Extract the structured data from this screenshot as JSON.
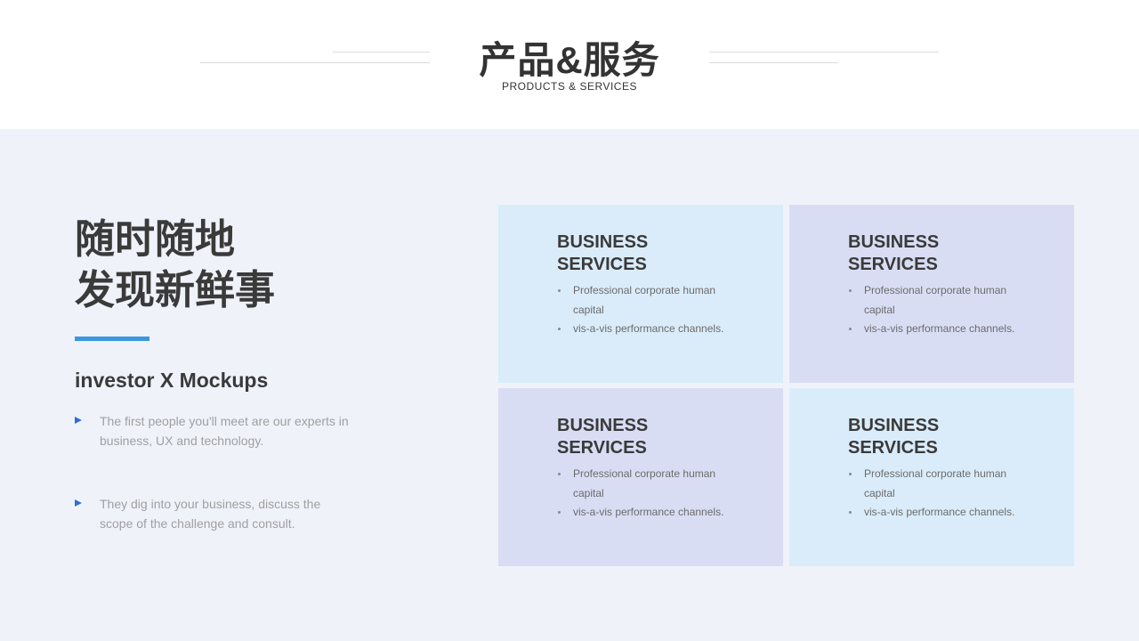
{
  "header": {
    "title": "产品&服务",
    "subtitle": "PRODUCTS & SERVICES"
  },
  "left": {
    "headline_line1": "随时随地",
    "headline_line2": "发现新鲜事",
    "subheading": "investor X Mockups",
    "bullets": [
      "The first people you'll meet are our experts in business, UX  and technology.",
      "They dig into your business, discuss the scope of the challenge and consult."
    ]
  },
  "cards": [
    {
      "title_line1": "BUSINESS",
      "title_line2": "SERVICES",
      "items": [
        "Professional corporate human capital",
        "vis-a-vis performance channels."
      ],
      "color": "#daecfa"
    },
    {
      "title_line1": "BUSINESS",
      "title_line2": "SERVICES",
      "items": [
        "Professional corporate human capital",
        "vis-a-vis performance channels."
      ],
      "color": "#d9ddf4"
    },
    {
      "title_line1": "BUSINESS",
      "title_line2": "SERVICES",
      "items": [
        "Professional corporate human capital",
        "vis-a-vis performance channels."
      ],
      "color": "#d9ddf4"
    },
    {
      "title_line1": "BUSINESS",
      "title_line2": "SERVICES",
      "items": [
        "Professional corporate human capital",
        "vis-a-vis performance channels."
      ],
      "color": "#daecfa"
    }
  ],
  "colors": {
    "accent": "#3c97dd",
    "arrow": "#2f6fd1",
    "background": "#f0f2fa"
  }
}
